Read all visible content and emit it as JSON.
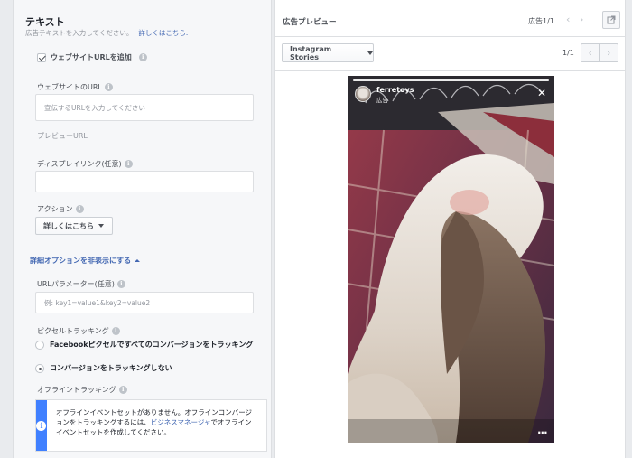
{
  "text_section": {
    "title": "テキスト",
    "subtitle": "広告テキストを入力してください。",
    "learn_more": "詳しくはこちら."
  },
  "website_url_checkbox": {
    "label": "ウェブサイトURLを追加",
    "checked": true
  },
  "website_url": {
    "label": "ウェブサイトのURL",
    "placeholder": "宣伝するURLを入力してください"
  },
  "preview_url_label": "プレビューURL",
  "display_link": {
    "label": "ディスプレイリンク(任意)",
    "value": ""
  },
  "action": {
    "label": "アクション",
    "selected": "詳しくはこちら"
  },
  "advanced_toggle": "詳細オプションを非表示にする",
  "url_params": {
    "label": "URLパラメーター(任意)",
    "placeholder": "例: key1=value1&key2=value2"
  },
  "pixel_tracking": {
    "label": "ピクセルトラッキング",
    "options": [
      {
        "label": "Facebookピクセルですべてのコンバージョンをトラッキング",
        "selected": false
      },
      {
        "label": "コンバージョンをトラッキングしない",
        "selected": true
      }
    ]
  },
  "offline_tracking": {
    "label": "オフライントラッキング",
    "notice_pre": "オフラインイベントセットがありません。オフラインコンバージョンをトラッキングするには、",
    "notice_link": "ビジネスマネージャ",
    "notice_post": "でオフラインイベントセットを作成してください。"
  },
  "preview": {
    "title": "広告プレビュー",
    "count": "広告1/1",
    "format": "Instagram Stories",
    "page": "1/1",
    "story": {
      "account": "ferretoys",
      "sponsored": "広告"
    }
  },
  "icons": {
    "info": "info-icon",
    "external": "external-link-icon",
    "close": "close-icon",
    "more": "more-dots-icon"
  },
  "colors": {
    "link": "#4267b2",
    "notice_bar": "#4080ff"
  }
}
